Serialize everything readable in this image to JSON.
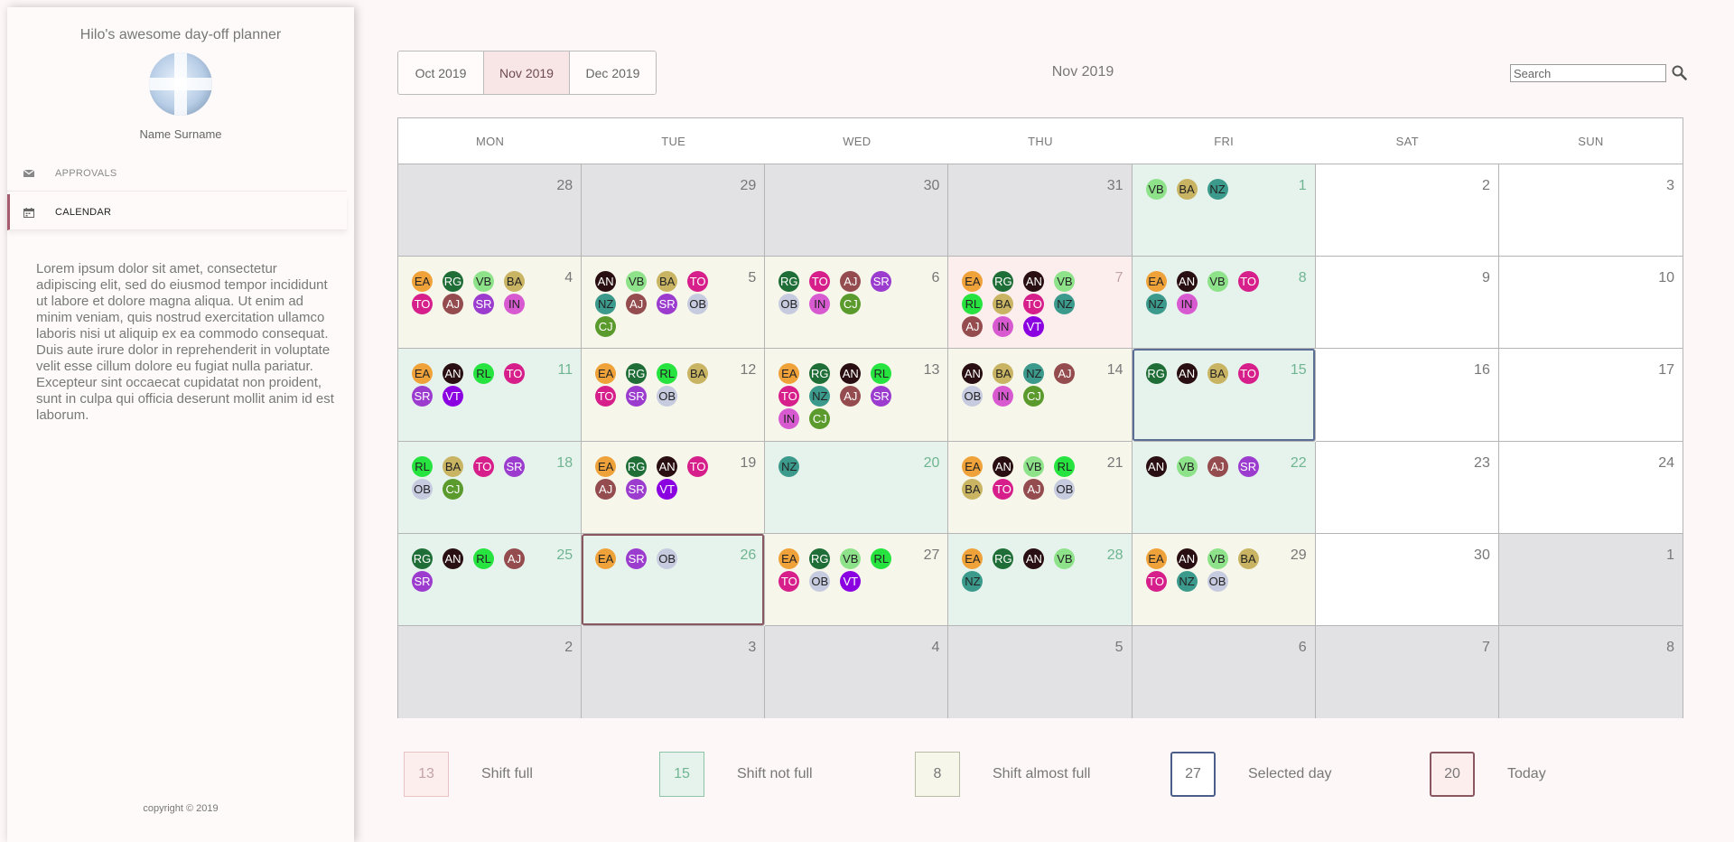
{
  "app": {
    "title": "Hilo's awesome day-off planner",
    "user_name": "Name Surname",
    "lorem": "Lorem ipsum dolor sit amet, consectetur adipiscing elit, sed do eiusmod tempor incididunt ut labore et dolore magna aliqua. Ut enim ad minim veniam, quis nostrud exercitation ullamco laboris nisi ut aliquip ex ea commodo consequat. Duis aute irure dolor in reprehenderit in voluptate velit esse cillum dolore eu fugiat nulla pariatur. Excepteur sint occaecat cupidatat non proident, sunt in culpa qui officia deserunt mollit anim id est laborum.",
    "copyright": "copyright © 2019"
  },
  "nav": {
    "items": [
      {
        "label": "APPROVALS",
        "icon": "envelope-icon",
        "active": false
      },
      {
        "label": "CALENDAR",
        "icon": "calendar-icon",
        "active": true
      }
    ]
  },
  "months": {
    "tabs": [
      {
        "label": "Oct 2019",
        "active": false
      },
      {
        "label": "Nov 2019",
        "active": true
      },
      {
        "label": "Dec 2019",
        "active": false
      }
    ],
    "current": "Nov 2019"
  },
  "search": {
    "placeholder": "Search",
    "value": ""
  },
  "weekdays": [
    "MON",
    "TUE",
    "WED",
    "THU",
    "FRI",
    "SAT",
    "SUN"
  ],
  "weeks": [
    [
      {
        "day": "28",
        "status": "outside",
        "people": []
      },
      {
        "day": "29",
        "status": "outside",
        "people": []
      },
      {
        "day": "30",
        "status": "outside",
        "people": []
      },
      {
        "day": "31",
        "status": "outside",
        "people": []
      },
      {
        "day": "1",
        "status": "notfull",
        "people": [
          "VB",
          "BA",
          "NZ"
        ]
      },
      {
        "day": "2",
        "status": "empty",
        "people": []
      },
      {
        "day": "3",
        "status": "empty",
        "people": []
      }
    ],
    [
      {
        "day": "4",
        "status": "almost",
        "people": [
          "EA",
          "RG",
          "VB",
          "BA",
          "TO",
          "AJ",
          "SR",
          "IN"
        ]
      },
      {
        "day": "5",
        "status": "almost",
        "people": [
          "AN",
          "VB",
          "BA",
          "TO",
          "NZ",
          "AJ",
          "SR",
          "OB",
          "CJ"
        ]
      },
      {
        "day": "6",
        "status": "almost",
        "people": [
          "RG",
          "TO",
          "AJ",
          "SR",
          "OB",
          "IN",
          "CJ"
        ]
      },
      {
        "day": "7",
        "status": "full",
        "people": [
          "EA",
          "RG",
          "AN",
          "VB",
          "RL",
          "BA",
          "TO",
          "NZ",
          "AJ",
          "IN",
          "VT"
        ]
      },
      {
        "day": "8",
        "status": "notfull",
        "people": [
          "EA",
          "AN",
          "VB",
          "TO",
          "NZ",
          "IN"
        ]
      },
      {
        "day": "9",
        "status": "empty",
        "people": []
      },
      {
        "day": "10",
        "status": "empty",
        "people": []
      }
    ],
    [
      {
        "day": "11",
        "status": "notfull",
        "people": [
          "EA",
          "AN",
          "RL",
          "TO",
          "SR",
          "VT"
        ]
      },
      {
        "day": "12",
        "status": "almost",
        "people": [
          "EA",
          "RG",
          "RL",
          "BA",
          "TO",
          "SR",
          "OB"
        ]
      },
      {
        "day": "13",
        "status": "almost",
        "people": [
          "EA",
          "RG",
          "AN",
          "RL",
          "TO",
          "NZ",
          "AJ",
          "SR",
          "IN",
          "CJ"
        ]
      },
      {
        "day": "14",
        "status": "almost",
        "people": [
          "AN",
          "BA",
          "NZ",
          "AJ",
          "OB",
          "IN",
          "CJ"
        ]
      },
      {
        "day": "15",
        "status": "notfull",
        "selected": true,
        "people": [
          "RG",
          "AN",
          "BA",
          "TO"
        ]
      },
      {
        "day": "16",
        "status": "empty",
        "people": []
      },
      {
        "day": "17",
        "status": "empty",
        "people": []
      }
    ],
    [
      {
        "day": "18",
        "status": "notfull",
        "people": [
          "RL",
          "BA",
          "TO",
          "SR",
          "OB",
          "CJ"
        ]
      },
      {
        "day": "19",
        "status": "almost",
        "people": [
          "EA",
          "RG",
          "AN",
          "TO",
          "AJ",
          "SR",
          "VT"
        ]
      },
      {
        "day": "20",
        "status": "notfull",
        "people": [
          "NZ"
        ]
      },
      {
        "day": "21",
        "status": "almost",
        "people": [
          "EA",
          "AN",
          "VB",
          "RL",
          "BA",
          "TO",
          "AJ",
          "OB"
        ]
      },
      {
        "day": "22",
        "status": "notfull",
        "people": [
          "AN",
          "VB",
          "AJ",
          "SR"
        ]
      },
      {
        "day": "23",
        "status": "empty",
        "people": []
      },
      {
        "day": "24",
        "status": "empty",
        "people": []
      }
    ],
    [
      {
        "day": "25",
        "status": "notfull",
        "people": [
          "RG",
          "AN",
          "RL",
          "AJ",
          "SR"
        ]
      },
      {
        "day": "26",
        "status": "notfull",
        "today": true,
        "people": [
          "EA",
          "SR",
          "OB"
        ]
      },
      {
        "day": "27",
        "status": "almost",
        "people": [
          "EA",
          "RG",
          "VB",
          "RL",
          "TO",
          "OB",
          "VT"
        ]
      },
      {
        "day": "28",
        "status": "notfull",
        "people": [
          "EA",
          "RG",
          "AN",
          "VB",
          "NZ"
        ]
      },
      {
        "day": "29",
        "status": "almost",
        "people": [
          "EA",
          "AN",
          "VB",
          "BA",
          "TO",
          "NZ",
          "OB"
        ]
      },
      {
        "day": "30",
        "status": "empty",
        "people": []
      },
      {
        "day": "1",
        "status": "outside",
        "people": []
      }
    ],
    [
      {
        "day": "2",
        "status": "outside",
        "people": []
      },
      {
        "day": "3",
        "status": "outside",
        "people": []
      },
      {
        "day": "4",
        "status": "outside",
        "people": []
      },
      {
        "day": "5",
        "status": "outside",
        "people": []
      },
      {
        "day": "6",
        "status": "outside",
        "people": []
      },
      {
        "day": "7",
        "status": "outside",
        "people": []
      },
      {
        "day": "8",
        "status": "outside",
        "people": []
      }
    ]
  ],
  "legend": [
    {
      "number": "13",
      "label": "Shift full",
      "kind": "full"
    },
    {
      "number": "15",
      "label": "Shift not full",
      "kind": "notfull"
    },
    {
      "number": "8",
      "label": "Shift almost full",
      "kind": "almost"
    },
    {
      "number": "27",
      "label": "Selected day",
      "kind": "selected"
    },
    {
      "number": "20",
      "label": "Today",
      "kind": "today"
    }
  ],
  "colors": {
    "accent": "#a75b6e",
    "selected_border": "#5a6e96",
    "today_border": "#8a5761",
    "shift_full": "#fdeeee",
    "shift_not_full": "#e6f3ec",
    "shift_almost_full": "#f6f7ea",
    "outside_month": "#e2e1e3"
  }
}
